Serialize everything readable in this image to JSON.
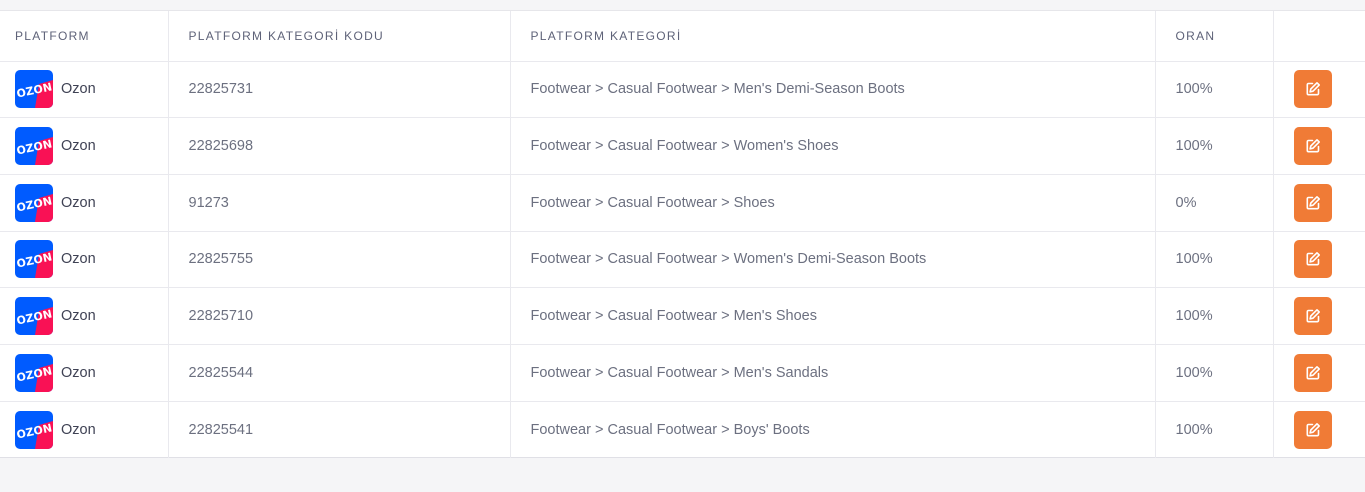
{
  "table": {
    "headers": [
      "PLATFORM",
      "PLATFORM KATEGORİ KODU",
      "PLATFORM KATEGORİ",
      "ORAN",
      ""
    ],
    "rows": [
      {
        "platform": "Ozon",
        "logo_text": "OZON",
        "code": "22825731",
        "category": "Footwear > Casual Footwear > Men's Demi-Season Boots",
        "rate": "100%"
      },
      {
        "platform": "Ozon",
        "logo_text": "OZON",
        "code": "22825698",
        "category": "Footwear > Casual Footwear > Women's Shoes",
        "rate": "100%"
      },
      {
        "platform": "Ozon",
        "logo_text": "OZON",
        "code": "91273",
        "category": "Footwear > Casual Footwear > Shoes",
        "rate": "0%"
      },
      {
        "platform": "Ozon",
        "logo_text": "OZON",
        "code": "22825755",
        "category": "Footwear > Casual Footwear > Women's Demi-Season Boots",
        "rate": "100%"
      },
      {
        "platform": "Ozon",
        "logo_text": "OZON",
        "code": "22825710",
        "category": "Footwear > Casual Footwear > Men's Shoes",
        "rate": "100%"
      },
      {
        "platform": "Ozon",
        "logo_text": "OZON",
        "code": "22825544",
        "category": "Footwear > Casual Footwear > Men's Sandals",
        "rate": "100%"
      },
      {
        "platform": "Ozon",
        "logo_text": "OZON",
        "code": "22825541",
        "category": "Footwear > Casual Footwear > Boys' Boots",
        "rate": "100%"
      }
    ]
  },
  "icons": {
    "row_logo": "ozon-logo-icon",
    "row_action": "edit-icon"
  },
  "colors": {
    "edit_button": "#f07b36",
    "ozon_blue": "#005bff",
    "ozon_pink": "#f91155"
  }
}
